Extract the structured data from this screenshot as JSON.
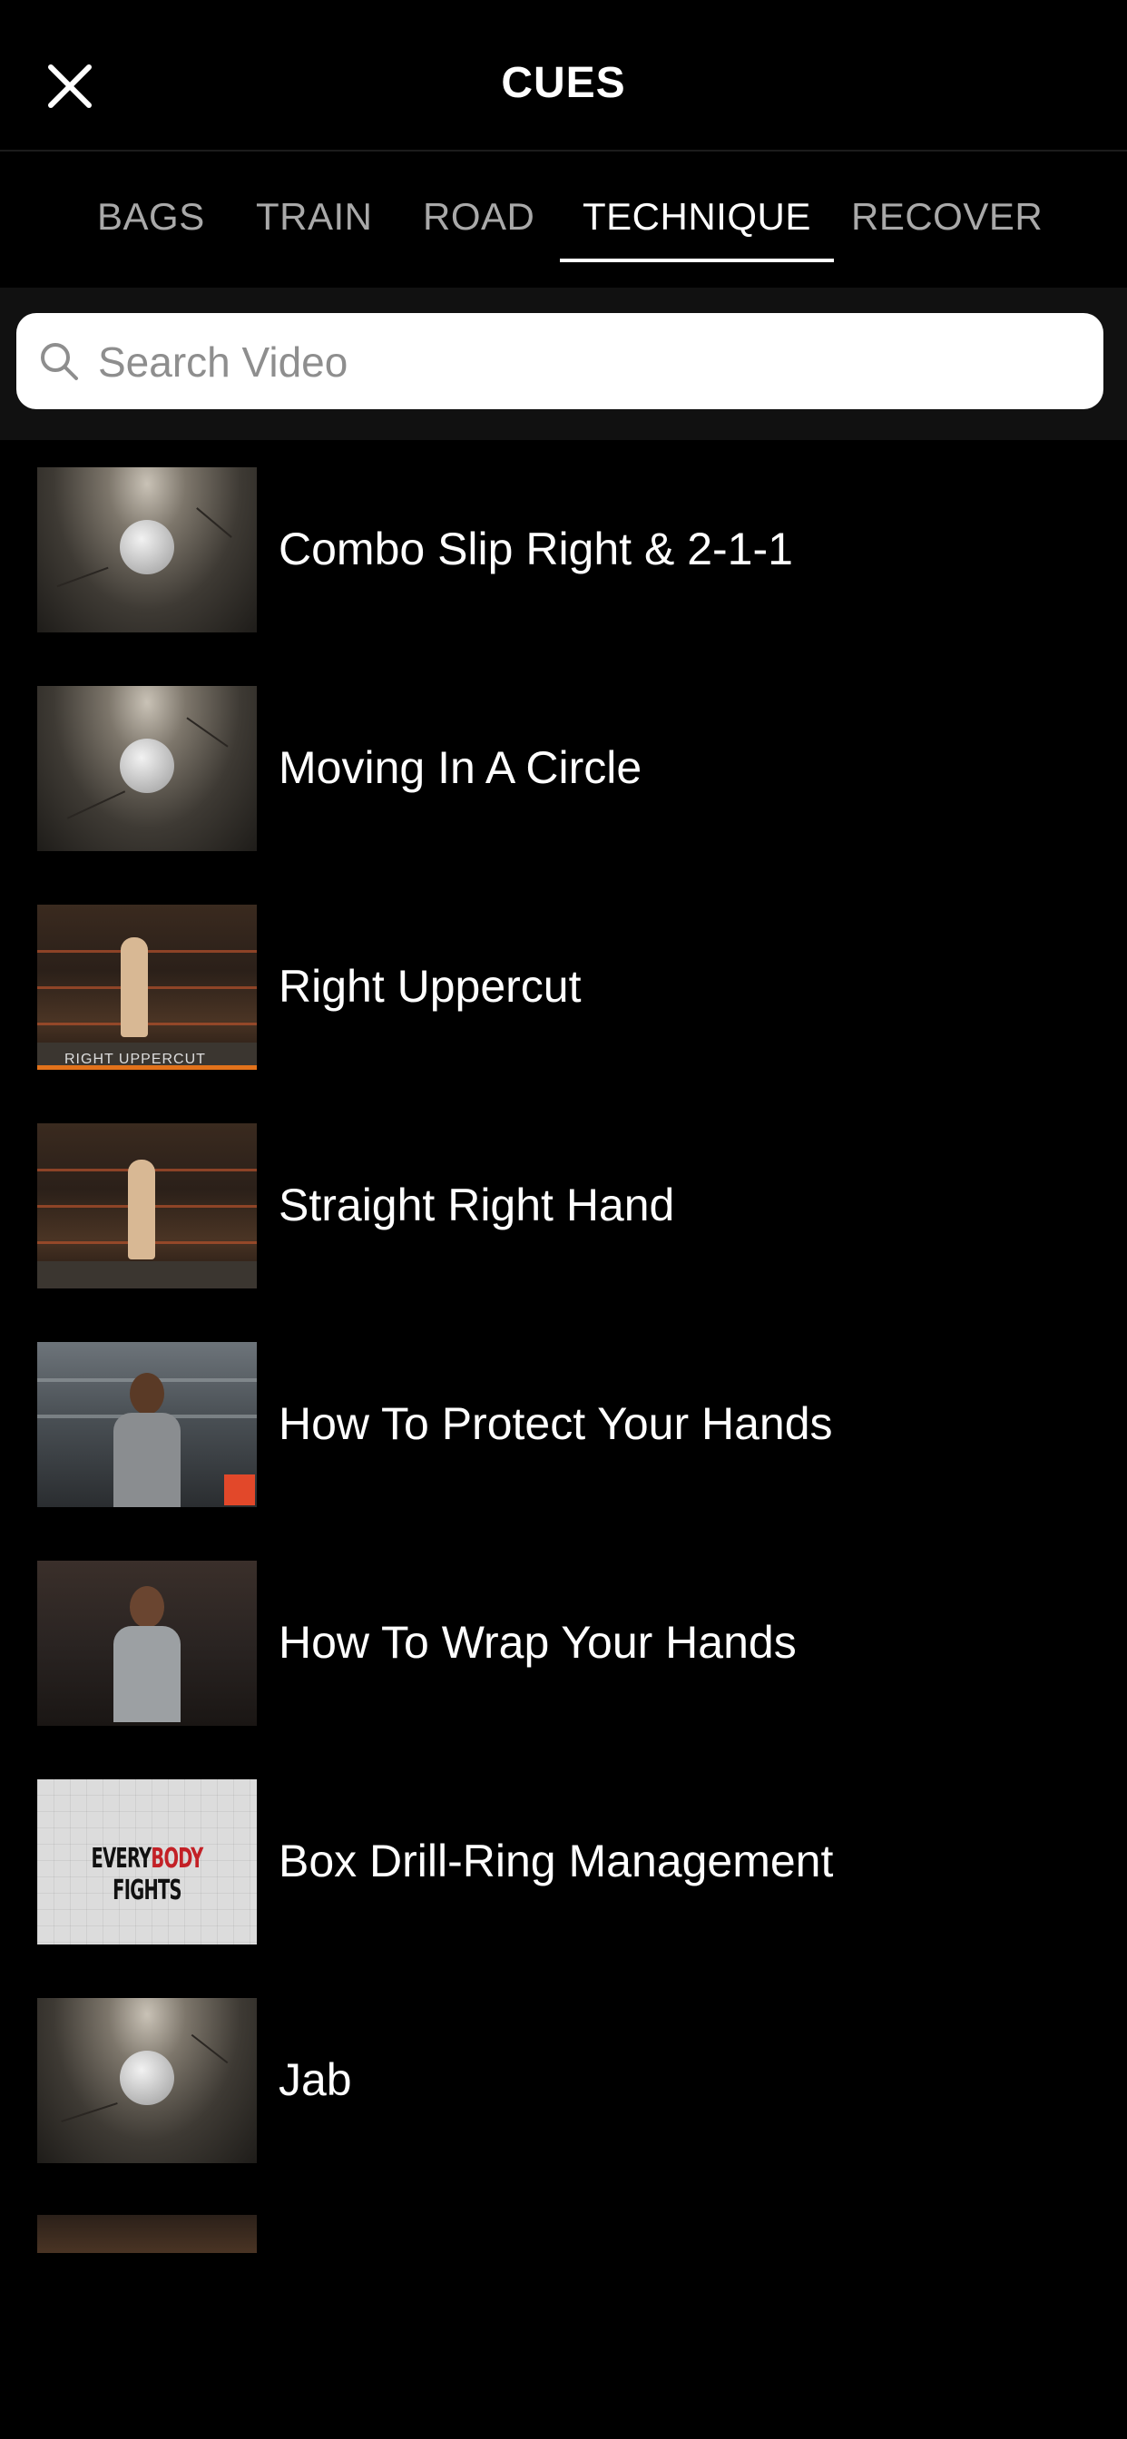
{
  "header": {
    "title": "CUES"
  },
  "tabs": [
    {
      "label": "BAGS",
      "active": false
    },
    {
      "label": "TRAIN",
      "active": false
    },
    {
      "label": "ROAD",
      "active": false
    },
    {
      "label": "TECHNIQUE",
      "active": true
    },
    {
      "label": "RECOVER",
      "active": false
    }
  ],
  "search": {
    "placeholder": "Search Video",
    "value": ""
  },
  "videos": [
    {
      "title": "Combo Slip Right &  2-1-1",
      "thumbnail": "logo"
    },
    {
      "title": "Moving In A Circle",
      "thumbnail": "logo"
    },
    {
      "title": "Right Uppercut",
      "thumbnail": "gym",
      "thumbnail_caption": "RIGHT UPPERCUT"
    },
    {
      "title": "Straight Right Hand",
      "thumbnail": "gym"
    },
    {
      "title": "How To Protect Your Hands",
      "thumbnail": "coach"
    },
    {
      "title": "How To Wrap Your Hands",
      "thumbnail": "coach"
    },
    {
      "title": "Box Drill-Ring Management",
      "thumbnail": "fights",
      "thumbnail_text_parts": [
        "EVERY",
        "BODY",
        " FIGHTS"
      ]
    },
    {
      "title": "Jab",
      "thumbnail": "logo"
    }
  ],
  "colors": {
    "background": "#000000",
    "accent": "#ffffff",
    "inactive_tab": "#a9a9a9",
    "brand_red": "#c32026"
  }
}
